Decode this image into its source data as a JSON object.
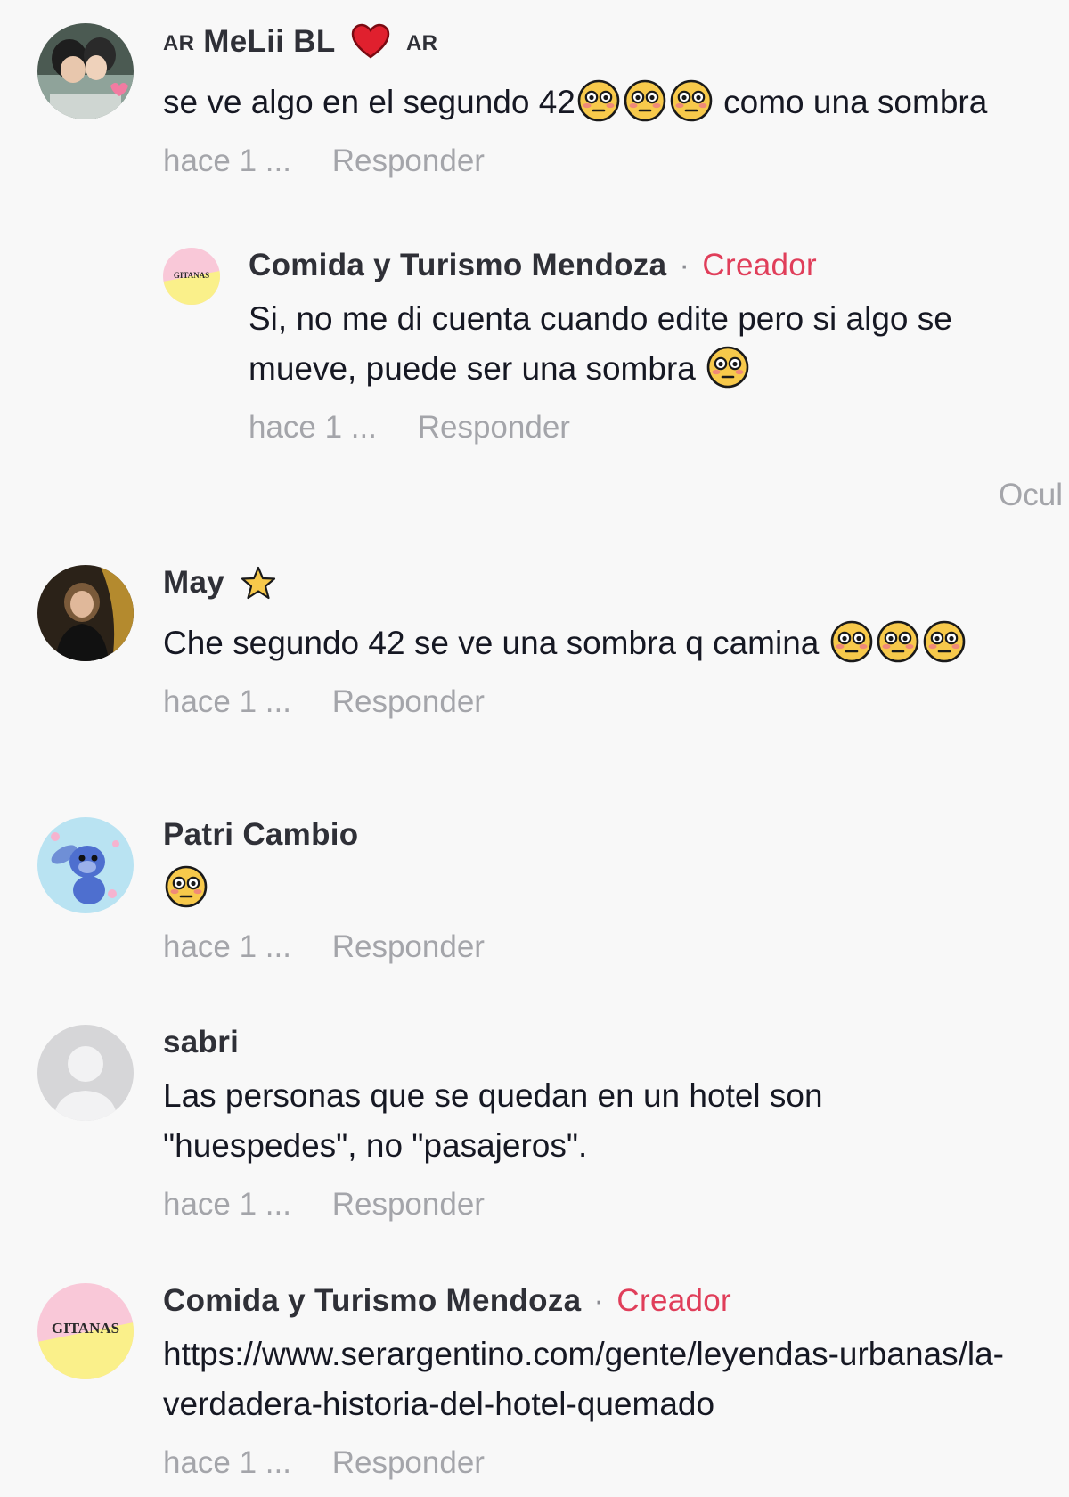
{
  "comments": [
    {
      "flag_prefix": "AR",
      "author": "MeLii BL",
      "flag_suffix": "AR",
      "text_before": "se ve algo en el segundo 42",
      "emoji_count": 3,
      "text_after": " como una sombra",
      "time": "hace 1 ...",
      "reply_label": "Responder",
      "reply": {
        "author": "Comida y Turismo Mendoza",
        "separator": "·",
        "badge": "Creador",
        "avatar_text": "GITANAS",
        "text": "Si, no me di cuenta cuando edite pero si algo se mueve, puede ser una sombra",
        "time": "hace 1 ...",
        "reply_label": "Responder"
      },
      "hide_label": "Ocul"
    },
    {
      "author": "May",
      "text": "Che segundo 42 se ve una sombra q camina",
      "time": "hace 1 ...",
      "reply_label": "Responder"
    },
    {
      "author": "Patri Cambio",
      "time": "hace 1 ...",
      "reply_label": "Responder"
    },
    {
      "author": "sabri",
      "text": "Las personas que se quedan en un hotel son \"huespedes\", no \"pasajeros\".",
      "time": "hace 1 ...",
      "reply_label": "Responder"
    },
    {
      "author": "Comida y Turismo Mendoza",
      "separator": "·",
      "badge": "Creador",
      "avatar_text": "GITANAS",
      "text": "https://www.serargentino.com/gente/leyendas-urbanas/la-verdadera-historia-del-hotel-quemado",
      "time": "hace 1 ...",
      "reply_label": "Responder"
    }
  ],
  "icons": {
    "emoji": "flushed-face-emoji",
    "heart": "red-heart-icon",
    "star": "star-icon",
    "default_avatar": "default-user-avatar"
  },
  "colors": {
    "background": "#f8f8f8",
    "text": "#161823",
    "muted": "#a4a5aa",
    "creator": "#e03e5a"
  }
}
